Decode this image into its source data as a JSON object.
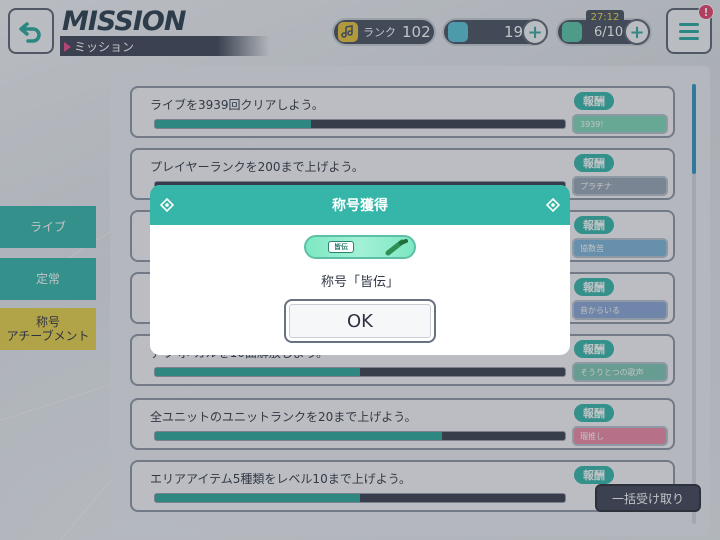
{
  "header": {
    "title": "MISSION",
    "subtitle": "ミッション",
    "rank_label": "ランク",
    "rank_value": "102",
    "crystals": "195",
    "stamina_timer": "27:12",
    "stamina": "6/10",
    "plus_symbol": "+",
    "notification_badge": "!",
    "icons": {
      "back": "back-arrow-icon",
      "rank": "music-note-icon",
      "crystal": "crystal-icon",
      "stamina": "live-bonus-icon",
      "menu": "hamburger-menu-icon"
    }
  },
  "tabs": [
    {
      "label": "ライブ",
      "color": "#36b6a9"
    },
    {
      "label": "定常",
      "color": "#36b6a9"
    },
    {
      "label": "称号\nアチーブメント",
      "color": "#e9d24b"
    }
  ],
  "missions": [
    {
      "text": "ライブを3939回クリアしよう。",
      "progress": 0.38,
      "reward_label": "報酬",
      "reward_item": "3939!",
      "reward_color": "#7fd9b8"
    },
    {
      "text": "プレイヤーランクを200まで上げよう。",
      "progress": 0.0,
      "reward_label": "報酬",
      "reward_item": "プラチナ",
      "reward_color": "#9aa7b8"
    },
    {
      "text": "",
      "progress": 0.0,
      "reward_label": "報酬",
      "reward_item": "協数苦",
      "reward_color": "#7db6d8"
    },
    {
      "text": "",
      "progress": 0.0,
      "reward_label": "報酬",
      "reward_item": "音からいる",
      "reward_color": "#8aa6d6"
    },
    {
      "text": "ァラ ボ カルを10曲解放しよう。",
      "progress": 0.5,
      "reward_label": "報酬",
      "reward_item": "そうりとつの歌声",
      "reward_color": "#7fc7b5"
    },
    {
      "text": "全ユニットのユニットランクを20まで上げよう。",
      "progress": 0.7,
      "reward_label": "報酬",
      "reward_item": "瑠推し",
      "reward_color": "#f08aa6"
    },
    {
      "text": "エリアアイテム5種類をレベル10まで上げよう。",
      "progress": 0.5,
      "reward_label": "報酬",
      "reward_item": "",
      "reward_color": "#e8c870"
    }
  ],
  "bulk_receive": "一括受け取り",
  "dialog": {
    "header": "称号獲得",
    "badge_mini": "皆伝",
    "message": "称号「皆伝」",
    "ok_label": "OK"
  },
  "colors": {
    "accent": "#36b6a9",
    "dark": "#3f4656",
    "progress_fill": "#2fa99c"
  }
}
